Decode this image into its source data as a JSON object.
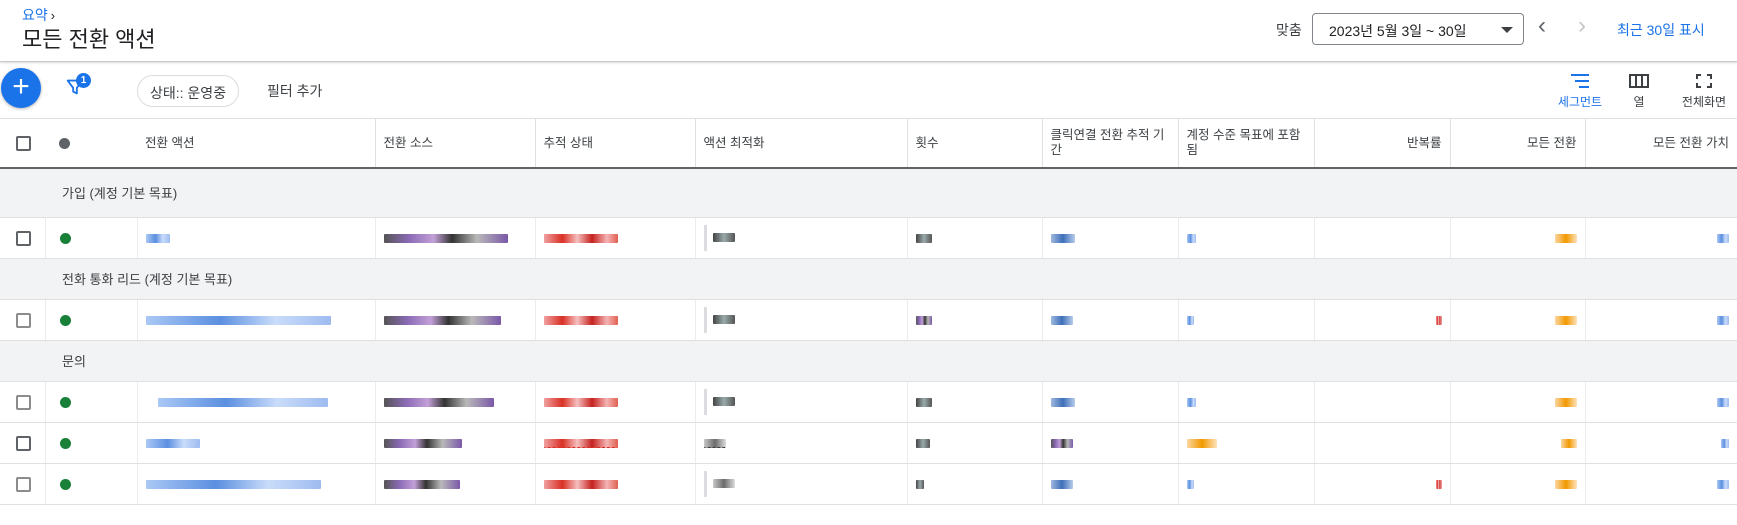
{
  "header": {
    "breadcrumb": "요약",
    "title": "모든 전환 액션",
    "date_label": "맞춤",
    "date_range": "2023년 5월 3일 ~ 30일",
    "recent_link": "최근 30일 표시"
  },
  "toolbar": {
    "filter_count": "1",
    "status_chip": "상태:: 운영중",
    "add_filter": "필터 추가",
    "segment": "세그먼트",
    "columns": "열",
    "fullscreen": "전체화면"
  },
  "table": {
    "columns": [
      "전환 액션",
      "전환 소스",
      "추적 상태",
      "액션 최적화",
      "횟수",
      "클릭연결 전환 추적 기간",
      "계정 수준 목표에 포함됨",
      "반복률",
      "모든 전환",
      "모든 전환 가치"
    ],
    "groups": [
      {
        "label": "가입 (계정 기본 목표)",
        "rows": 1
      },
      {
        "label": "전화 통화 리드 (계정 기본 목표)",
        "rows": 1
      },
      {
        "label": "문의",
        "rows": 3
      }
    ]
  },
  "colors": {
    "accent": "#1a73e8",
    "status_active": "#188038",
    "group_bg": "#f1f3f4"
  }
}
